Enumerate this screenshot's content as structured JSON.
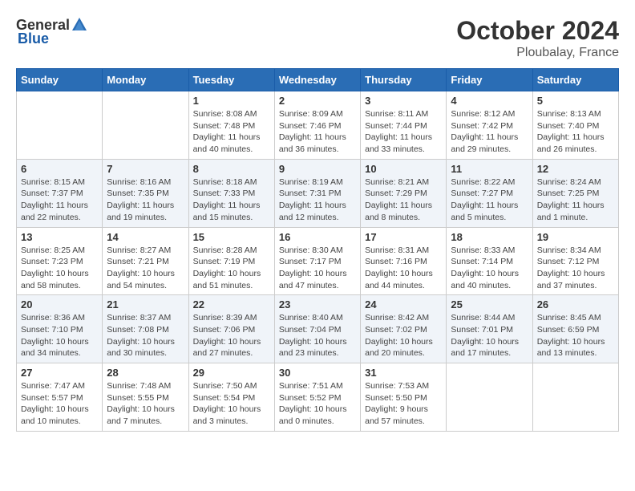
{
  "header": {
    "logo_general": "General",
    "logo_blue": "Blue",
    "month": "October 2024",
    "location": "Ploubalay, France"
  },
  "columns": [
    "Sunday",
    "Monday",
    "Tuesday",
    "Wednesday",
    "Thursday",
    "Friday",
    "Saturday"
  ],
  "weeks": [
    [
      {
        "day": "",
        "sunrise": "",
        "sunset": "",
        "daylight": "",
        "empty": true
      },
      {
        "day": "",
        "sunrise": "",
        "sunset": "",
        "daylight": "",
        "empty": true
      },
      {
        "day": "1",
        "sunrise": "Sunrise: 8:08 AM",
        "sunset": "Sunset: 7:48 PM",
        "daylight": "Daylight: 11 hours and 40 minutes."
      },
      {
        "day": "2",
        "sunrise": "Sunrise: 8:09 AM",
        "sunset": "Sunset: 7:46 PM",
        "daylight": "Daylight: 11 hours and 36 minutes."
      },
      {
        "day": "3",
        "sunrise": "Sunrise: 8:11 AM",
        "sunset": "Sunset: 7:44 PM",
        "daylight": "Daylight: 11 hours and 33 minutes."
      },
      {
        "day": "4",
        "sunrise": "Sunrise: 8:12 AM",
        "sunset": "Sunset: 7:42 PM",
        "daylight": "Daylight: 11 hours and 29 minutes."
      },
      {
        "day": "5",
        "sunrise": "Sunrise: 8:13 AM",
        "sunset": "Sunset: 7:40 PM",
        "daylight": "Daylight: 11 hours and 26 minutes."
      }
    ],
    [
      {
        "day": "6",
        "sunrise": "Sunrise: 8:15 AM",
        "sunset": "Sunset: 7:37 PM",
        "daylight": "Daylight: 11 hours and 22 minutes."
      },
      {
        "day": "7",
        "sunrise": "Sunrise: 8:16 AM",
        "sunset": "Sunset: 7:35 PM",
        "daylight": "Daylight: 11 hours and 19 minutes."
      },
      {
        "day": "8",
        "sunrise": "Sunrise: 8:18 AM",
        "sunset": "Sunset: 7:33 PM",
        "daylight": "Daylight: 11 hours and 15 minutes."
      },
      {
        "day": "9",
        "sunrise": "Sunrise: 8:19 AM",
        "sunset": "Sunset: 7:31 PM",
        "daylight": "Daylight: 11 hours and 12 minutes."
      },
      {
        "day": "10",
        "sunrise": "Sunrise: 8:21 AM",
        "sunset": "Sunset: 7:29 PM",
        "daylight": "Daylight: 11 hours and 8 minutes."
      },
      {
        "day": "11",
        "sunrise": "Sunrise: 8:22 AM",
        "sunset": "Sunset: 7:27 PM",
        "daylight": "Daylight: 11 hours and 5 minutes."
      },
      {
        "day": "12",
        "sunrise": "Sunrise: 8:24 AM",
        "sunset": "Sunset: 7:25 PM",
        "daylight": "Daylight: 11 hours and 1 minute."
      }
    ],
    [
      {
        "day": "13",
        "sunrise": "Sunrise: 8:25 AM",
        "sunset": "Sunset: 7:23 PM",
        "daylight": "Daylight: 10 hours and 58 minutes."
      },
      {
        "day": "14",
        "sunrise": "Sunrise: 8:27 AM",
        "sunset": "Sunset: 7:21 PM",
        "daylight": "Daylight: 10 hours and 54 minutes."
      },
      {
        "day": "15",
        "sunrise": "Sunrise: 8:28 AM",
        "sunset": "Sunset: 7:19 PM",
        "daylight": "Daylight: 10 hours and 51 minutes."
      },
      {
        "day": "16",
        "sunrise": "Sunrise: 8:30 AM",
        "sunset": "Sunset: 7:17 PM",
        "daylight": "Daylight: 10 hours and 47 minutes."
      },
      {
        "day": "17",
        "sunrise": "Sunrise: 8:31 AM",
        "sunset": "Sunset: 7:16 PM",
        "daylight": "Daylight: 10 hours and 44 minutes."
      },
      {
        "day": "18",
        "sunrise": "Sunrise: 8:33 AM",
        "sunset": "Sunset: 7:14 PM",
        "daylight": "Daylight: 10 hours and 40 minutes."
      },
      {
        "day": "19",
        "sunrise": "Sunrise: 8:34 AM",
        "sunset": "Sunset: 7:12 PM",
        "daylight": "Daylight: 10 hours and 37 minutes."
      }
    ],
    [
      {
        "day": "20",
        "sunrise": "Sunrise: 8:36 AM",
        "sunset": "Sunset: 7:10 PM",
        "daylight": "Daylight: 10 hours and 34 minutes."
      },
      {
        "day": "21",
        "sunrise": "Sunrise: 8:37 AM",
        "sunset": "Sunset: 7:08 PM",
        "daylight": "Daylight: 10 hours and 30 minutes."
      },
      {
        "day": "22",
        "sunrise": "Sunrise: 8:39 AM",
        "sunset": "Sunset: 7:06 PM",
        "daylight": "Daylight: 10 hours and 27 minutes."
      },
      {
        "day": "23",
        "sunrise": "Sunrise: 8:40 AM",
        "sunset": "Sunset: 7:04 PM",
        "daylight": "Daylight: 10 hours and 23 minutes."
      },
      {
        "day": "24",
        "sunrise": "Sunrise: 8:42 AM",
        "sunset": "Sunset: 7:02 PM",
        "daylight": "Daylight: 10 hours and 20 minutes."
      },
      {
        "day": "25",
        "sunrise": "Sunrise: 8:44 AM",
        "sunset": "Sunset: 7:01 PM",
        "daylight": "Daylight: 10 hours and 17 minutes."
      },
      {
        "day": "26",
        "sunrise": "Sunrise: 8:45 AM",
        "sunset": "Sunset: 6:59 PM",
        "daylight": "Daylight: 10 hours and 13 minutes."
      }
    ],
    [
      {
        "day": "27",
        "sunrise": "Sunrise: 7:47 AM",
        "sunset": "Sunset: 5:57 PM",
        "daylight": "Daylight: 10 hours and 10 minutes."
      },
      {
        "day": "28",
        "sunrise": "Sunrise: 7:48 AM",
        "sunset": "Sunset: 5:55 PM",
        "daylight": "Daylight: 10 hours and 7 minutes."
      },
      {
        "day": "29",
        "sunrise": "Sunrise: 7:50 AM",
        "sunset": "Sunset: 5:54 PM",
        "daylight": "Daylight: 10 hours and 3 minutes."
      },
      {
        "day": "30",
        "sunrise": "Sunrise: 7:51 AM",
        "sunset": "Sunset: 5:52 PM",
        "daylight": "Daylight: 10 hours and 0 minutes."
      },
      {
        "day": "31",
        "sunrise": "Sunrise: 7:53 AM",
        "sunset": "Sunset: 5:50 PM",
        "daylight": "Daylight: 9 hours and 57 minutes."
      },
      {
        "day": "",
        "sunrise": "",
        "sunset": "",
        "daylight": "",
        "empty": true
      },
      {
        "day": "",
        "sunrise": "",
        "sunset": "",
        "daylight": "",
        "empty": true
      }
    ]
  ]
}
